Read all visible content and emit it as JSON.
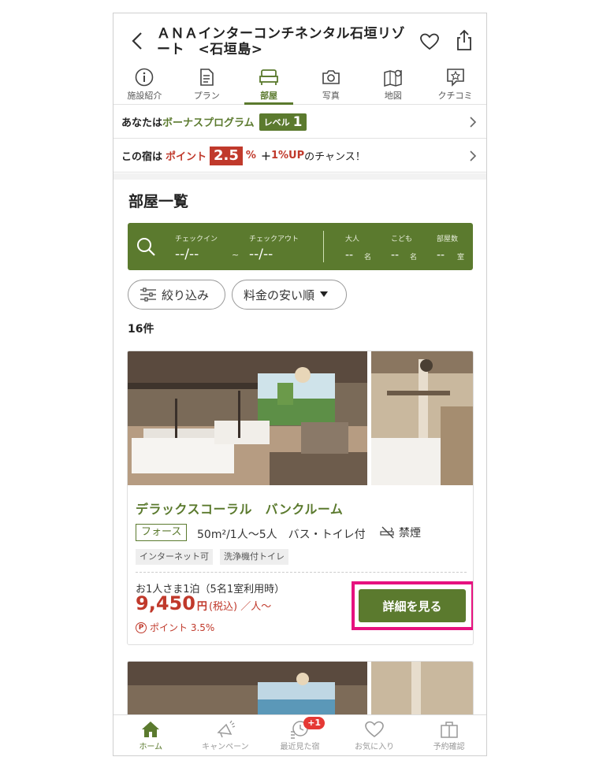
{
  "header": {
    "title": "ＡＮＡインターコンチネンタル石垣リゾート　<石垣島>"
  },
  "tabs": [
    {
      "label": "施設紹介",
      "icon": "info-icon"
    },
    {
      "label": "プラン",
      "icon": "document-icon"
    },
    {
      "label": "部屋",
      "icon": "bed-icon",
      "active": true
    },
    {
      "label": "写真",
      "icon": "camera-icon"
    },
    {
      "label": "地図",
      "icon": "map-icon"
    },
    {
      "label": "クチコミ",
      "icon": "review-icon"
    }
  ],
  "bonus": {
    "prefix": "あなたは",
    "program": "ボーナスプログラム",
    "level_label": "レベル",
    "level_value": "1"
  },
  "points_row": {
    "prefix": "この宿は",
    "point_label": "ポイント",
    "rate": "2.5",
    "unit": "%",
    "plus": "＋",
    "extra": "1%UP",
    "suffix": "のチャンス！"
  },
  "section_title": "部屋一覧",
  "search": {
    "checkin_label": "チェックイン",
    "checkin_value": "--/--",
    "tilde": "~",
    "checkout_label": "チェックアウト",
    "checkout_value": "--/--",
    "adults_label": "大人",
    "adults_value": "--",
    "adults_unit": "名",
    "children_label": "こども",
    "children_value": "--",
    "children_unit": "名",
    "rooms_label": "部屋数",
    "rooms_value": "--",
    "rooms_unit": "室"
  },
  "filters": {
    "narrow_label": "絞り込み",
    "sort_label": "料金の安い順"
  },
  "result_count": "16件",
  "room": {
    "name": "デラックスコーラル　バンクルーム",
    "tag": "フォース",
    "spec": "50m²/1人〜5人　バス・トイレ付",
    "smoking": "禁煙",
    "chips": [
      "インターネット可",
      "洗浄機付トイレ"
    ],
    "per_note": "お1人さま1泊（5名1室利用時）",
    "price": "9,450",
    "price_unit": "円",
    "price_tax": "(税込) ／人〜",
    "points_icon": "P",
    "points": "ポイント 3.5%",
    "detail_button": "詳細を見る"
  },
  "bottom_nav": [
    {
      "label": "ホーム",
      "icon": "home-icon",
      "active": true
    },
    {
      "label": "キャンペーン",
      "icon": "megaphone-icon"
    },
    {
      "label": "最近見た宿",
      "icon": "history-icon",
      "badge": "+1"
    },
    {
      "label": "お気に入り",
      "icon": "heart-icon"
    },
    {
      "label": "予約確認",
      "icon": "reservation-icon"
    }
  ],
  "colors": {
    "brand_green": "#5b7a2e",
    "accent_red": "#c0392b",
    "highlight_pink": "#e6127f"
  }
}
